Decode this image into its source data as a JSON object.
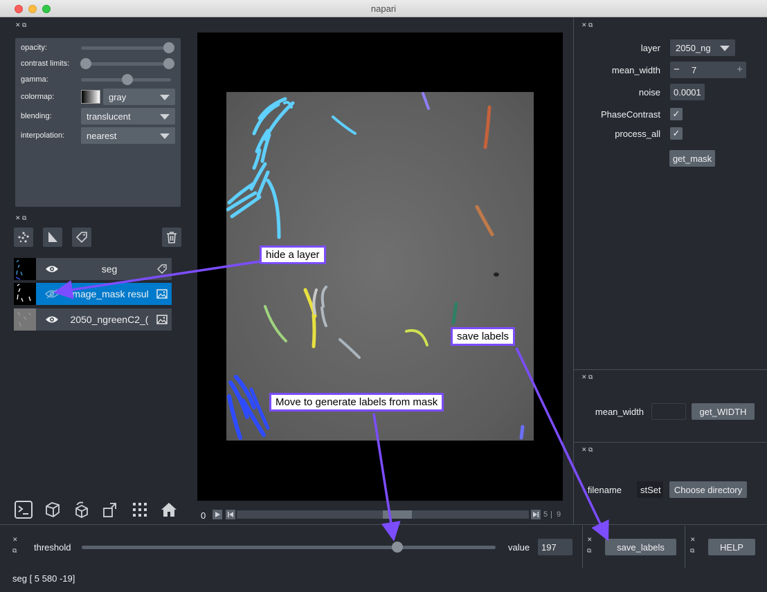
{
  "window": {
    "title": "napari"
  },
  "layer_controls": {
    "opacity_label": "opacity:",
    "opacity_value": 1.0,
    "contrast_label": "contrast limits:",
    "contrast_range": [
      0.0,
      1.0
    ],
    "gamma_label": "gamma:",
    "gamma_value": 0.5,
    "colormap_label": "colormap:",
    "colormap_value": "gray",
    "blending_label": "blending:",
    "blending_value": "translucent",
    "interpolation_label": "interpolation:",
    "interpolation_value": "nearest"
  },
  "layers": [
    {
      "name": "seg",
      "visible": true,
      "selected": false,
      "type_icon": "tag-icon"
    },
    {
      "name": "image_mask resul",
      "visible": false,
      "selected": true,
      "type_icon": "image-icon"
    },
    {
      "name": "2050_ngreenC2_(",
      "visible": true,
      "selected": false,
      "type_icon": "image-icon"
    }
  ],
  "dims": {
    "current": "0",
    "slider_pos": 0.5,
    "end": "5",
    "total": "9"
  },
  "right_panel": {
    "layer_label": "layer",
    "layer_value": "2050_ng",
    "mean_width_label": "mean_width",
    "mean_width_value": "7",
    "minus": "−",
    "plus": "+",
    "noise_label": "noise",
    "noise_value": "0.0001",
    "phase_label": "PhaseContrast",
    "process_label": "process_all",
    "check_mark": "✓",
    "get_mask": "get_mask"
  },
  "width_panel": {
    "mean_width_label": "mean_width",
    "mean_width_value": "",
    "get_width": "get_WIDTH"
  },
  "file_panel": {
    "filename_label": "filename",
    "filename_value": "stSet",
    "choose": "Choose directory"
  },
  "threshold_panel": {
    "label": "threshold",
    "slider_pos": 0.75,
    "value_label": "value",
    "value": "197"
  },
  "save_panel": {
    "button": "save_labels"
  },
  "help_panel": {
    "button": "HELP"
  },
  "annotations": {
    "hide_layer": "hide a layer",
    "save_labels": "save labels",
    "move_generate": "Move to generate labels from mask"
  },
  "status": "seg [  5 580 -19]",
  "colors": {
    "accent": "#007acc",
    "annotation": "#7c4dff",
    "bg": "#262930",
    "panel": "#414851"
  }
}
